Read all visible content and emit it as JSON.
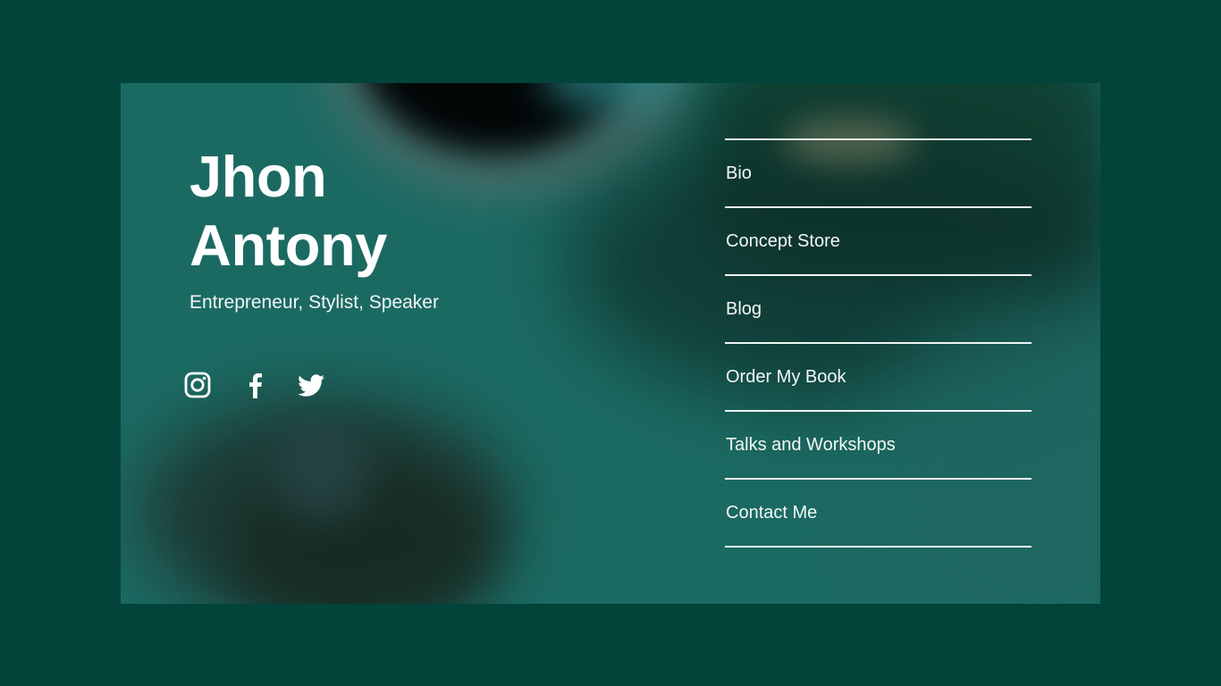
{
  "profile": {
    "first_name": "Jhon",
    "last_name": "Antony",
    "tagline": "Entrepreneur, Stylist, Speaker"
  },
  "social": [
    {
      "icon": "instagram-icon",
      "label": "Instagram"
    },
    {
      "icon": "facebook-icon",
      "label": "Facebook"
    },
    {
      "icon": "twitter-icon",
      "label": "Twitter"
    }
  ],
  "nav": {
    "items": [
      {
        "label": "Bio"
      },
      {
        "label": "Concept Store"
      },
      {
        "label": "Blog"
      },
      {
        "label": "Order My Book"
      },
      {
        "label": "Talks and Workshops"
      },
      {
        "label": "Contact Me"
      }
    ]
  },
  "colors": {
    "page_background": "#02443a",
    "card_background": "#1b6a62",
    "text": "#ffffff"
  }
}
